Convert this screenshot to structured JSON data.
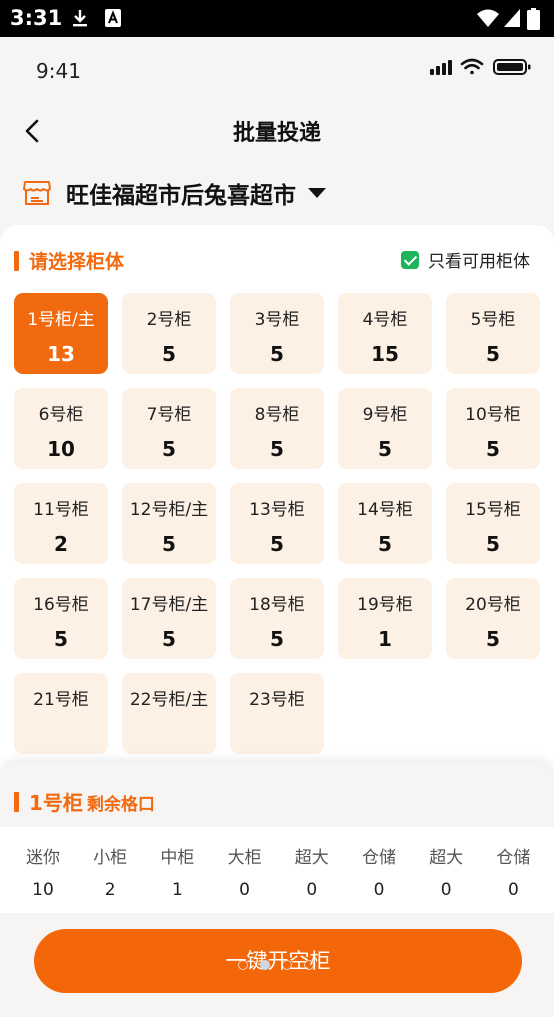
{
  "system": {
    "time": "3:31"
  },
  "ios": {
    "time": "9:41"
  },
  "nav": {
    "title": "批量投递"
  },
  "store": {
    "name": "旺佳福超市后兔喜超市"
  },
  "section": {
    "title": "请选择柜体",
    "filter_label": "只看可用柜体",
    "filter_checked": true
  },
  "cabinets": [
    {
      "name": "1号柜/主",
      "count": "13",
      "selected": true
    },
    {
      "name": "2号柜",
      "count": "5"
    },
    {
      "name": "3号柜",
      "count": "5"
    },
    {
      "name": "4号柜",
      "count": "15"
    },
    {
      "name": "5号柜",
      "count": "5"
    },
    {
      "name": "6号柜",
      "count": "10"
    },
    {
      "name": "7号柜",
      "count": "5"
    },
    {
      "name": "8号柜",
      "count": "5"
    },
    {
      "name": "9号柜",
      "count": "5"
    },
    {
      "name": "10号柜",
      "count": "5"
    },
    {
      "name": "11号柜",
      "count": "2"
    },
    {
      "name": "12号柜/主",
      "count": "5"
    },
    {
      "name": "13号柜",
      "count": "5"
    },
    {
      "name": "14号柜",
      "count": "5"
    },
    {
      "name": "15号柜",
      "count": "5"
    },
    {
      "name": "16号柜",
      "count": "5"
    },
    {
      "name": "17号柜/主",
      "count": "5"
    },
    {
      "name": "18号柜",
      "count": "5"
    },
    {
      "name": "19号柜",
      "count": "1"
    },
    {
      "name": "20号柜",
      "count": "5"
    },
    {
      "name": "21号柜",
      "count": ""
    },
    {
      "name": "22号柜/主",
      "count": ""
    },
    {
      "name": "23号柜",
      "count": ""
    }
  ],
  "sheet": {
    "cabinet": "1号柜",
    "subtitle": "剩余格口",
    "sizes": [
      {
        "label": "迷你",
        "value": "10"
      },
      {
        "label": "小柜",
        "value": "2"
      },
      {
        "label": "中柜",
        "value": "1"
      },
      {
        "label": "大柜",
        "value": "0"
      },
      {
        "label": "超大",
        "value": "0"
      },
      {
        "label": "仓储",
        "value": "0"
      },
      {
        "label": "超大",
        "value": "0"
      },
      {
        "label": "仓储",
        "value": "0"
      }
    ],
    "button_label": "一键开空柜"
  },
  "colors": {
    "accent": "#f26a10",
    "tile_bg": "#fdf0e4",
    "check": "#1fb35b"
  }
}
